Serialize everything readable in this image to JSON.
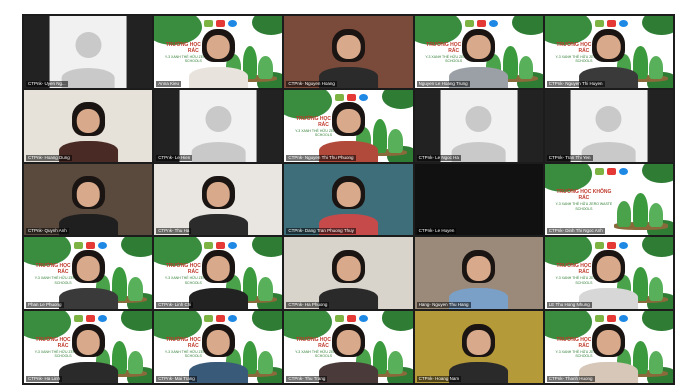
{
  "meeting": {
    "tiles": [
      {
        "name": "CTPnk- Uyen Ng...",
        "kind": "placeholder"
      },
      {
        "name": "Anna Kieu",
        "kind": "video-slide",
        "shirt": "#e8e3dc"
      },
      {
        "name": "CTPnk- Nguyen Hoang",
        "kind": "video-room",
        "bg": "#7a4a3a",
        "shirt": "#2b2b2b"
      },
      {
        "name": "Nguyen Le Hoang Trung",
        "kind": "video-slide",
        "shirt": "#9aa0a6"
      },
      {
        "name": "CTPnk- Nguyen Thi Huyen",
        "kind": "video-slide",
        "shirt": "#3a3a3a"
      },
      {
        "name": "CTPnk- Hoang Dung",
        "kind": "video-room",
        "bg": "#e6e2da",
        "shirt": "#4a2a24"
      },
      {
        "name": "CTPnk- Le Hien",
        "kind": "placeholder"
      },
      {
        "name": "CTPnk- Nguyen Thi Thu Phuong",
        "kind": "video-slide",
        "shirt": "#b14a3a"
      },
      {
        "name": "CTPnk- Le Ngoc Ha",
        "kind": "placeholder"
      },
      {
        "name": "CTPnk- Tran Thi Yen",
        "kind": "placeholder"
      },
      {
        "name": "CTPnk- Quynh Anh",
        "kind": "video-room",
        "bg": "#5a4a3e",
        "shirt": "#1f1f1f"
      },
      {
        "name": "CTPnk- Thu Ha",
        "kind": "video-room",
        "bg": "#e9e6e1",
        "shirt": "#2b2b2b"
      },
      {
        "name": "CTPnk- Dang Tran Phuong Thuy",
        "kind": "video-room",
        "bg": "#3e6e7a",
        "shirt": "#c64a4a"
      },
      {
        "name": "CTPnk- Le Huyen",
        "kind": "placeholder-dark"
      },
      {
        "name": "CTPnk- Dinh Thi Ngoc Anh",
        "kind": "slide"
      },
      {
        "name": "Phan Le Phuong",
        "kind": "video-slide",
        "shirt": "#3a3a3a"
      },
      {
        "name": "CTPnk- Linh Chi",
        "kind": "video-slide",
        "shirt": "#222222"
      },
      {
        "name": "CTPnk- Ha Phuong",
        "kind": "video-room",
        "bg": "#d8d4cc",
        "shirt": "#2a2a2a"
      },
      {
        "name": "Hang- Nguyen Thu Hang",
        "kind": "video-room",
        "bg": "#9b8a7a",
        "shirt": "#7aa0c8"
      },
      {
        "name": "LE Thu Hong Nhung",
        "kind": "video-slide",
        "shirt": "#d7d7d7"
      },
      {
        "name": "CTPnk- Ha Linh",
        "kind": "video-slide",
        "shirt": "#2a2a2a"
      },
      {
        "name": "CTPnk- Mai Trang",
        "kind": "video-slide",
        "shirt": "#3a5a7a"
      },
      {
        "name": "CTPnk- Thu Trang",
        "kind": "video-slide",
        "shirt": "#4a3a3a"
      },
      {
        "name": "CTPnk- Hoang Nam",
        "kind": "video-room",
        "bg": "#b59a3a",
        "shirt": "#2a2a2a"
      },
      {
        "name": "CTPnk- Thanh Huong",
        "kind": "video-slide",
        "shirt": "#d6c7b8"
      }
    ]
  },
  "slide": {
    "title": "TRƯỜNG HỌC KHÔNG RÁC",
    "subtitle": "Y-3 XANH THỂ HỮU\nZERO WASTE SCHOOLS"
  },
  "colors": {
    "grid": "#1c1c1c",
    "slide_green": "#3a8d3f",
    "slide_title": "#c0392b"
  }
}
